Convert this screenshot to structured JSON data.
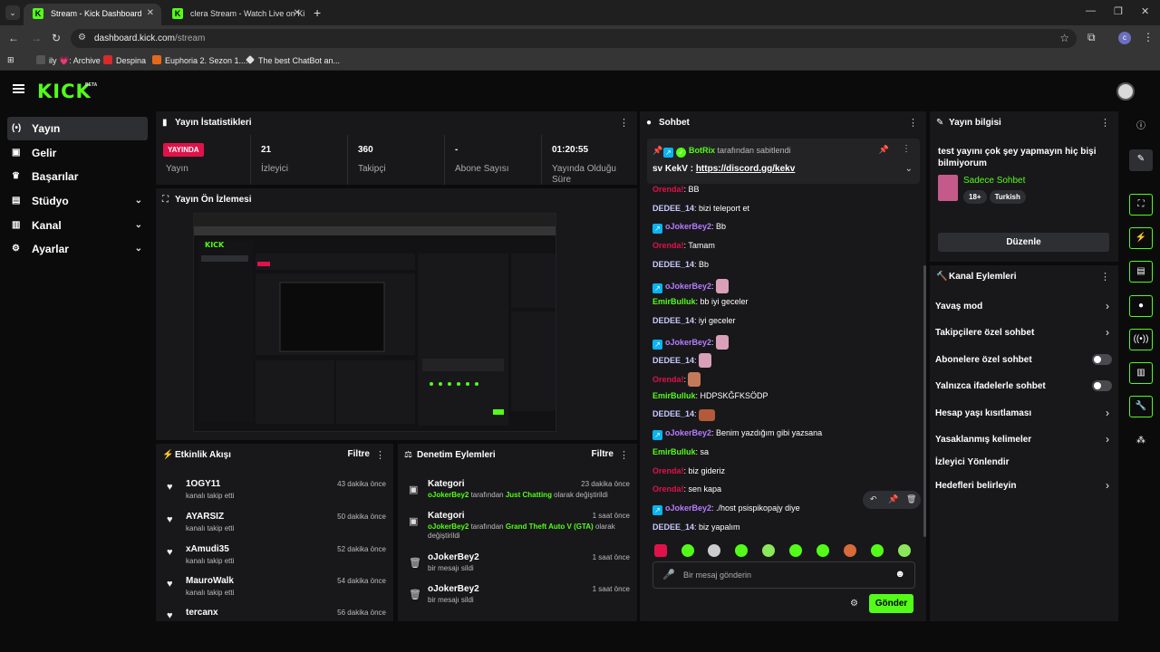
{
  "browser": {
    "tabs": [
      {
        "label": "Stream - Kick Dashboard"
      },
      {
        "label": "clera Stream - Watch Live on Ki"
      }
    ],
    "url_domain": "dashboard.kick.com",
    "url_path": "/stream",
    "bookmarks": [
      "ily 💗: Archive",
      "Despina",
      "Euphoria 2. Sezon 1....",
      "The best ChatBot an..."
    ]
  },
  "sidebar": {
    "items": [
      {
        "label": "Yayın",
        "icon": "broadcast-icon"
      },
      {
        "label": "Gelir",
        "icon": "card-icon"
      },
      {
        "label": "Başarılar",
        "icon": "trophy-icon"
      },
      {
        "label": "Stüdyo",
        "icon": "studio-icon"
      },
      {
        "label": "Kanal",
        "icon": "channel-icon"
      },
      {
        "label": "Ayarlar",
        "icon": "gear-icon"
      }
    ]
  },
  "stats": {
    "title": "Yayın İstatistikleri",
    "live_badge": "YAYINDA",
    "live_label": "Yayın",
    "items": [
      {
        "value": "21",
        "label": "İzleyici"
      },
      {
        "value": "360",
        "label": "Takipçi"
      },
      {
        "value": "-",
        "label": "Abone Sayısı"
      },
      {
        "value": "01:20:55",
        "label": "Yayında Olduğu Süre"
      }
    ]
  },
  "preview": {
    "title": "Yayın Ön İzlemesi"
  },
  "activity": {
    "title": "Etkinlik Akışı",
    "filter": "Filtre",
    "items": [
      {
        "name": "1OGY11",
        "sub": "kanalı takip etti",
        "time": "43 dakika önce"
      },
      {
        "name": "AYARSIZ",
        "sub": "kanalı takip etti",
        "time": "50 dakika önce"
      },
      {
        "name": "xAmudi35",
        "sub": "kanalı takip etti",
        "time": "52 dakika önce"
      },
      {
        "name": "MauroWalk",
        "sub": "kanalı takip etti",
        "time": "54 dakika önce"
      },
      {
        "name": "tercanx",
        "sub": "",
        "time": "56 dakika önce"
      }
    ]
  },
  "moderation": {
    "title": "Denetim Eylemleri",
    "filter": "Filtre",
    "items": [
      {
        "name": "Kategori",
        "user": "oJokerBey2",
        "mid": " tarafından ",
        "cat": "Just Chatting",
        "end": " olarak değiştirildi",
        "time": "23 dakika önce"
      },
      {
        "name": "Kategori",
        "user": "oJokerBey2",
        "mid": " tarafından ",
        "cat": "Grand Theft Auto V (GTA)",
        "end": " olarak değiştirildi",
        "time": "1 saat önce"
      },
      {
        "name": "oJokerBey2",
        "sub": "bir mesajı sildi",
        "time": "1 saat önce"
      },
      {
        "name": "oJokerBey2",
        "sub": "bir mesajı sildi",
        "time": "1 saat önce"
      }
    ]
  },
  "chat": {
    "title": "Sohbet",
    "pinned_by": "BotRix",
    "pinned_suffix": "tarafından sabitlendi",
    "pinned_msg_prefix": "sv KekV : ",
    "pinned_link": "https://discord.gg/kekv",
    "messages": [
      {
        "user": "Orenda!",
        "text": ": BB",
        "color": "#e0124a"
      },
      {
        "user": "DEDEE_14",
        "text": ": bizi teleport et",
        "color": "#c9c9ff"
      },
      {
        "user": "oJokerBey2",
        "text": ": Bb",
        "color": "#b67cff"
      },
      {
        "user": "Orenda!",
        "text": ": Tamam",
        "color": "#e0124a"
      },
      {
        "user": "DEDEE_14",
        "text": ": Bb",
        "color": "#c9c9ff"
      },
      {
        "user": "oJokerBey2",
        "text": ":",
        "color": "#b67cff"
      },
      {
        "user": "EmirBulluk",
        "text": ": bb iyi geceler",
        "color": "#53fc18"
      },
      {
        "user": "DEDEE_14",
        "text": ": iyi geceler",
        "color": "#c9c9ff"
      },
      {
        "user": "oJokerBey2",
        "text": ":",
        "color": "#b67cff"
      },
      {
        "user": "DEDEE_14",
        "text": ":",
        "color": "#c9c9ff"
      },
      {
        "user": "Orenda!",
        "text": ":",
        "color": "#e0124a"
      },
      {
        "user": "EmirBulluk",
        "text": ": HDPSKĞFKSÖDP",
        "color": "#53fc18"
      },
      {
        "user": "DEDEE_14",
        "text": ":",
        "color": "#c9c9ff"
      },
      {
        "user": "oJokerBey2",
        "text": ": Benim yazdığım gibi yazsana",
        "color": "#b67cff"
      },
      {
        "user": "EmirBulluk",
        "text": ": sa",
        "color": "#53fc18"
      },
      {
        "user": "Orenda!",
        "text": ": biz gideriz",
        "color": "#e0124a"
      },
      {
        "user": "Orenda!",
        "text": ": sen kapa",
        "color": "#e0124a"
      },
      {
        "user": "oJokerBey2",
        "text": ": ./host psispikopajy diye",
        "color": "#b67cff"
      },
      {
        "user": "DEDEE_14",
        "text": ": biz yapalım",
        "color": "#c9c9ff"
      }
    ],
    "input_placeholder": "Bir mesaj gönderin",
    "send_label": "Gönder"
  },
  "stream_info": {
    "title": "Yayın bilgisi",
    "stream_title": "test yayını çok şey yapmayın hiç bişi bilmiyorum",
    "category": "Sadece Sohbet",
    "tags": [
      "18+",
      "Turkish"
    ],
    "edit_label": "Düzenle"
  },
  "channel_actions": {
    "title": "Kanal Eylemleri",
    "items": [
      {
        "label": "Yavaş mod",
        "kind": "chevron"
      },
      {
        "label": "Takipçilere özel sohbet",
        "kind": "chevron"
      },
      {
        "label": "Abonelere özel sohbet",
        "kind": "toggle"
      },
      {
        "label": "Yalnızca ifadelerle sohbet",
        "kind": "toggle"
      },
      {
        "label": "Hesap yaşı kısıtlaması",
        "kind": "chevron"
      },
      {
        "label": "Yasaklanmış kelimeler",
        "kind": "chevron"
      },
      {
        "label": "İzleyici Yönlendir",
        "kind": "none"
      },
      {
        "label": "Hedefleri belirleyin",
        "kind": "chevron"
      }
    ]
  },
  "colors": {
    "accent": "#53fc18",
    "live": "#e0124a",
    "panel": "#18181b",
    "bg": "#0b0b0c"
  }
}
